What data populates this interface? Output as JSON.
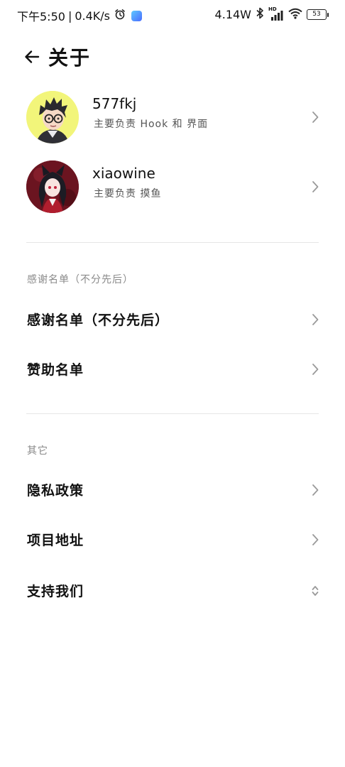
{
  "status_bar": {
    "time": "下午5:50",
    "separator": "|",
    "network_speed": "0.4K/s",
    "power": "4.14W",
    "hd_label": "HD",
    "battery": "53"
  },
  "header": {
    "title": "关于"
  },
  "developers": [
    {
      "name": "577fkj",
      "role": "主要负责 Hook 和 界面"
    },
    {
      "name": "xiaowine",
      "role": "主要负责 摸鱼"
    }
  ],
  "sections": [
    {
      "header": "感谢名单（不分先后）",
      "items": [
        {
          "label": "感谢名单（不分先后）",
          "icon": "chevron-right-icon"
        },
        {
          "label": "赞助名单",
          "icon": "chevron-right-icon"
        }
      ]
    },
    {
      "header": "其它",
      "items": [
        {
          "label": "隐私政策",
          "icon": "chevron-right-icon"
        },
        {
          "label": "项目地址",
          "icon": "chevron-right-icon"
        },
        {
          "label": "支持我们",
          "icon": "expand-collapse-icon"
        }
      ]
    }
  ],
  "colors": {
    "text_primary": "#111111",
    "text_secondary": "#555555",
    "section_header": "#8a8a8a",
    "chevron": "#9a9a9a",
    "divider": "#e6e6e6",
    "avatar1_bg": "#f2f57a",
    "avatar2_bg": "#6b1420"
  }
}
